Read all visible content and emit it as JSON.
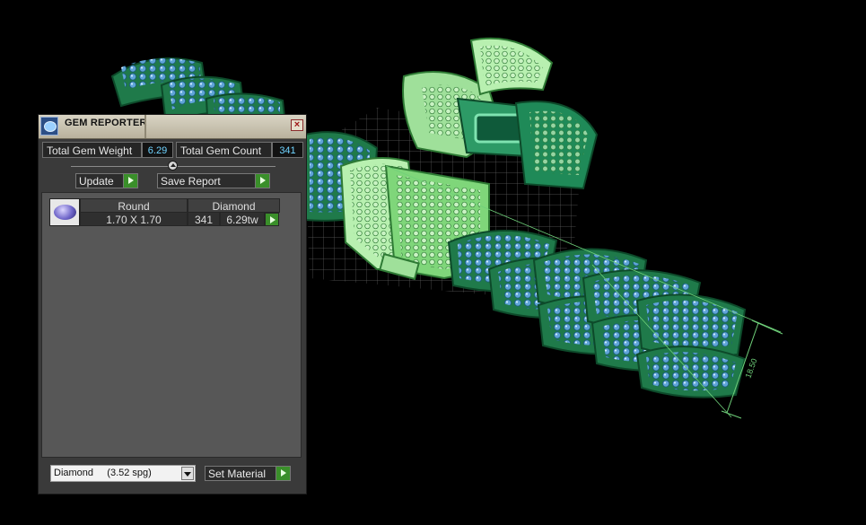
{
  "window": {
    "title": "GEM REPORTER"
  },
  "summary": {
    "total_weight_label": "Total Gem Weight",
    "total_weight_value": "6.29",
    "total_count_label": "Total Gem Count",
    "total_count_value": "341"
  },
  "buttons": {
    "update": "Update",
    "save_report": "Save Report",
    "set_material": "Set Material"
  },
  "gems": [
    {
      "shape": "Round",
      "size": "1.70 X 1.70",
      "material": "Diamond",
      "count": "341",
      "weight": "6.29tw"
    }
  ],
  "material_select": {
    "selected": "Diamond     (3.52 spg)"
  },
  "viewport": {
    "dimension_label": "18.50",
    "icon": "gem-thumbnail-icon"
  },
  "colors": {
    "accent_green": "#3a8f2a",
    "value_blue": "#6fd3ff",
    "link_green": "#1f7a4a",
    "stone_blue": "#5fa4d8"
  }
}
